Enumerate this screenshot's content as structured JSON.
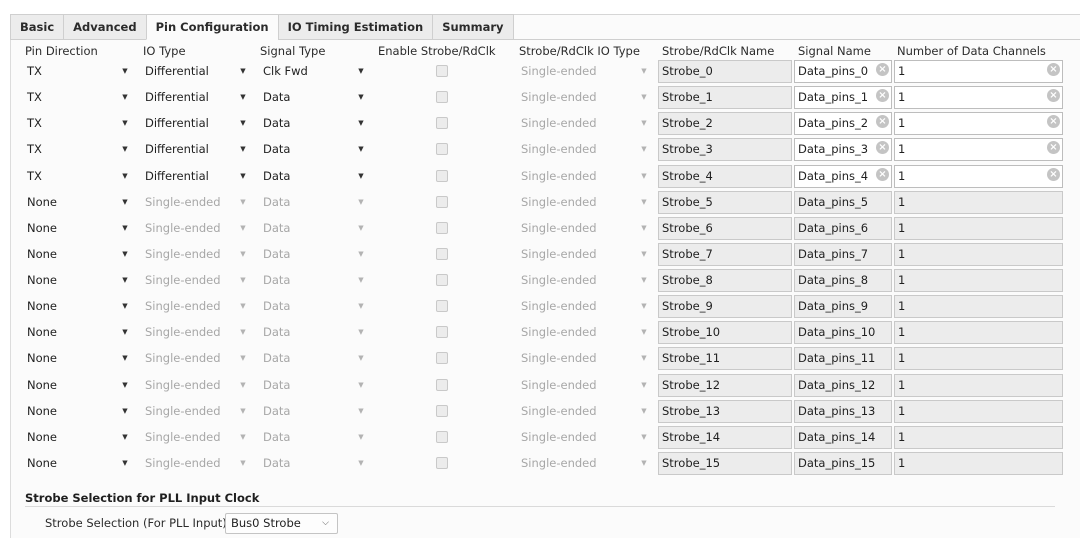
{
  "tabs": [
    "Basic",
    "Advanced",
    "Pin Configuration",
    "IO Timing Estimation",
    "Summary"
  ],
  "active_tab": 2,
  "columns": {
    "pin_direction": "Pin Direction",
    "io_type": "IO Type",
    "signal_type": "Signal Type",
    "enable_strobe": "Enable Strobe/RdClk",
    "strobe_io_type": "Strobe/RdClk IO Type",
    "strobe_name": "Strobe/RdClk Name",
    "signal_name": "Signal Name",
    "num_channels": "Number of Data Channels"
  },
  "rows": [
    {
      "pin_direction": "TX",
      "io_type": "Differential",
      "signal_type": "Clk Fwd",
      "strobe_io_type": "Single-ended",
      "strobe_name": "Strobe_0",
      "signal_name": "Data_pins_0",
      "num_channels": "1",
      "enabled": true
    },
    {
      "pin_direction": "TX",
      "io_type": "Differential",
      "signal_type": "Data",
      "strobe_io_type": "Single-ended",
      "strobe_name": "Strobe_1",
      "signal_name": "Data_pins_1",
      "num_channels": "1",
      "enabled": true
    },
    {
      "pin_direction": "TX",
      "io_type": "Differential",
      "signal_type": "Data",
      "strobe_io_type": "Single-ended",
      "strobe_name": "Strobe_2",
      "signal_name": "Data_pins_2",
      "num_channels": "1",
      "enabled": true
    },
    {
      "pin_direction": "TX",
      "io_type": "Differential",
      "signal_type": "Data",
      "strobe_io_type": "Single-ended",
      "strobe_name": "Strobe_3",
      "signal_name": "Data_pins_3",
      "num_channels": "1",
      "enabled": true
    },
    {
      "pin_direction": "TX",
      "io_type": "Differential",
      "signal_type": "Data",
      "strobe_io_type": "Single-ended",
      "strobe_name": "Strobe_4",
      "signal_name": "Data_pins_4",
      "num_channels": "1",
      "enabled": true
    },
    {
      "pin_direction": "None",
      "io_type": "Single-ended",
      "signal_type": "Data",
      "strobe_io_type": "Single-ended",
      "strobe_name": "Strobe_5",
      "signal_name": "Data_pins_5",
      "num_channels": "1",
      "enabled": false
    },
    {
      "pin_direction": "None",
      "io_type": "Single-ended",
      "signal_type": "Data",
      "strobe_io_type": "Single-ended",
      "strobe_name": "Strobe_6",
      "signal_name": "Data_pins_6",
      "num_channels": "1",
      "enabled": false
    },
    {
      "pin_direction": "None",
      "io_type": "Single-ended",
      "signal_type": "Data",
      "strobe_io_type": "Single-ended",
      "strobe_name": "Strobe_7",
      "signal_name": "Data_pins_7",
      "num_channels": "1",
      "enabled": false
    },
    {
      "pin_direction": "None",
      "io_type": "Single-ended",
      "signal_type": "Data",
      "strobe_io_type": "Single-ended",
      "strobe_name": "Strobe_8",
      "signal_name": "Data_pins_8",
      "num_channels": "1",
      "enabled": false
    },
    {
      "pin_direction": "None",
      "io_type": "Single-ended",
      "signal_type": "Data",
      "strobe_io_type": "Single-ended",
      "strobe_name": "Strobe_9",
      "signal_name": "Data_pins_9",
      "num_channels": "1",
      "enabled": false
    },
    {
      "pin_direction": "None",
      "io_type": "Single-ended",
      "signal_type": "Data",
      "strobe_io_type": "Single-ended",
      "strobe_name": "Strobe_10",
      "signal_name": "Data_pins_10",
      "num_channels": "1",
      "enabled": false
    },
    {
      "pin_direction": "None",
      "io_type": "Single-ended",
      "signal_type": "Data",
      "strobe_io_type": "Single-ended",
      "strobe_name": "Strobe_11",
      "signal_name": "Data_pins_11",
      "num_channels": "1",
      "enabled": false
    },
    {
      "pin_direction": "None",
      "io_type": "Single-ended",
      "signal_type": "Data",
      "strobe_io_type": "Single-ended",
      "strobe_name": "Strobe_12",
      "signal_name": "Data_pins_12",
      "num_channels": "1",
      "enabled": false
    },
    {
      "pin_direction": "None",
      "io_type": "Single-ended",
      "signal_type": "Data",
      "strobe_io_type": "Single-ended",
      "strobe_name": "Strobe_13",
      "signal_name": "Data_pins_13",
      "num_channels": "1",
      "enabled": false
    },
    {
      "pin_direction": "None",
      "io_type": "Single-ended",
      "signal_type": "Data",
      "strobe_io_type": "Single-ended",
      "strobe_name": "Strobe_14",
      "signal_name": "Data_pins_14",
      "num_channels": "1",
      "enabled": false
    },
    {
      "pin_direction": "None",
      "io_type": "Single-ended",
      "signal_type": "Data",
      "strobe_io_type": "Single-ended",
      "strobe_name": "Strobe_15",
      "signal_name": "Data_pins_15",
      "num_channels": "1",
      "enabled": false
    }
  ],
  "strobe_section": {
    "title": "Strobe Selection for PLL Input Clock",
    "label": "Strobe Selection (For PLL Input)",
    "value": "Bus0 Strobe"
  },
  "icons": {
    "dropdown": "triangle-down-icon",
    "clear": "clear-circle-icon",
    "chevron": "chevron-down-icon"
  }
}
